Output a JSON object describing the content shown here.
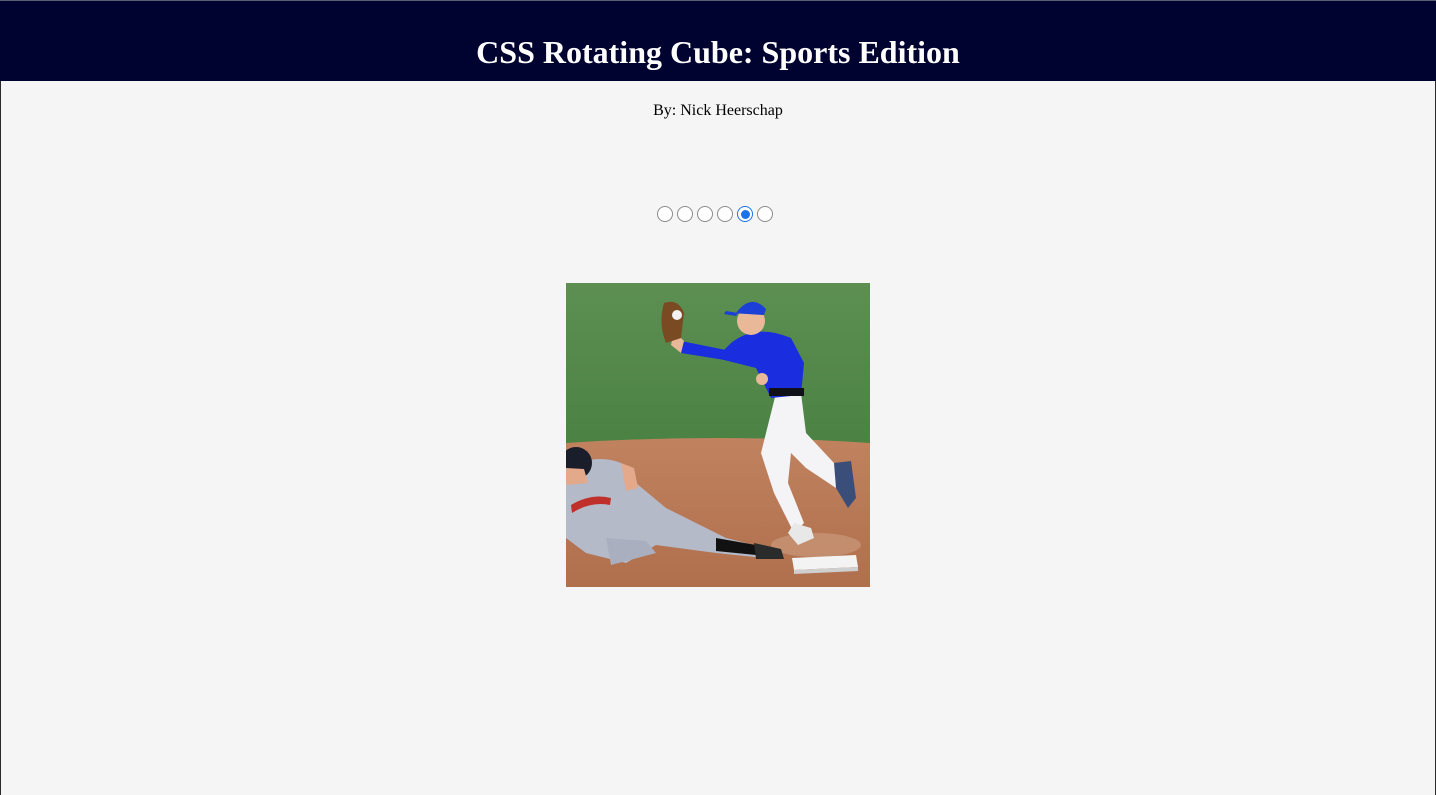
{
  "header": {
    "title": "CSS Rotating Cube: Sports Edition"
  },
  "byline": "By: Nick Heerschap",
  "radios": {
    "count": 6,
    "selected_index": 4,
    "options": [
      "",
      "",
      "",
      "",
      "",
      ""
    ]
  },
  "cube": {
    "visible_face": "baseball-slide-photo"
  },
  "colors": {
    "header_bg": "#000330",
    "page_bg": "#f5f5f5",
    "radio_accent": "#1a73e8"
  }
}
